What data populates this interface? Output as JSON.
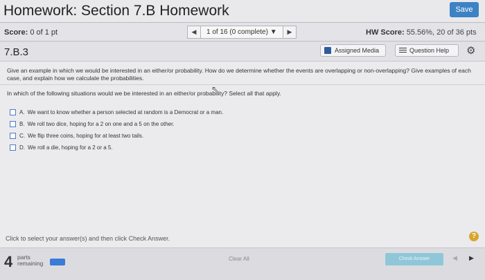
{
  "header": {
    "title": "Homework: Section 7.B Homework",
    "save_label": "Save"
  },
  "score_bar": {
    "score_label": "Score:",
    "score_value": "0 of 1 pt",
    "nav_prev": "◀",
    "nav_select": "1 of 16 (0 complete) ▼",
    "nav_next": "▶",
    "hw_score_label": "HW Score:",
    "hw_score_value": "55.56%, 20 of 36 pts"
  },
  "question_bar": {
    "id": "7.B.3",
    "assigned_media": "Assigned Media",
    "question_help": "Question Help",
    "gear": "⚙"
  },
  "content": {
    "prompt": "Give an example in which we would be interested in an either/or probability. How do we determine whether the events are overlapping or non-overlapping? Give examples of each case, and explain how we calculate the probabilities.",
    "question": "In which of the following situations would we be interested in an either/or probability? Select all that apply.",
    "options": [
      {
        "letter": "A.",
        "text": "We want to know whether a person selected at random is a Democrat or a man."
      },
      {
        "letter": "B.",
        "text": "We roll two dice, hoping for a 2 on one and a 5 on the other."
      },
      {
        "letter": "C.",
        "text": "We flip three coins, hoping for at least two tails."
      },
      {
        "letter": "D.",
        "text": "We roll a die, hoping for a 2 or a 5."
      }
    ],
    "instructions": "Click to select your answer(s) and then click Check Answer.",
    "help_icon": "?"
  },
  "footer": {
    "parts_count": "4",
    "parts_label_line1": "parts",
    "parts_label_line2": "remaining",
    "clear_all": "Clear All",
    "check_answer": "Check Answer",
    "prev": "◀",
    "next": "▶"
  }
}
